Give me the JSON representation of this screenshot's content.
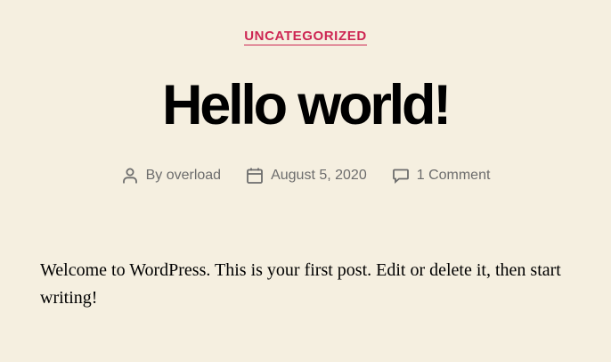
{
  "post": {
    "category": "UNCATEGORIZED",
    "title": "Hello world!",
    "meta": {
      "author_prefix": "By",
      "author": "overload",
      "date": "August 5, 2020",
      "comments": "1 Comment"
    },
    "body": "Welcome to WordPress. This is your first post. Edit or delete it, then start writing!"
  },
  "colors": {
    "background": "#f5efe0",
    "accent": "#cd2653",
    "meta_text": "#6d6d6d",
    "text": "#000000"
  },
  "icons": {
    "author": "person-icon",
    "date": "calendar-icon",
    "comments": "comment-bubble-icon"
  }
}
